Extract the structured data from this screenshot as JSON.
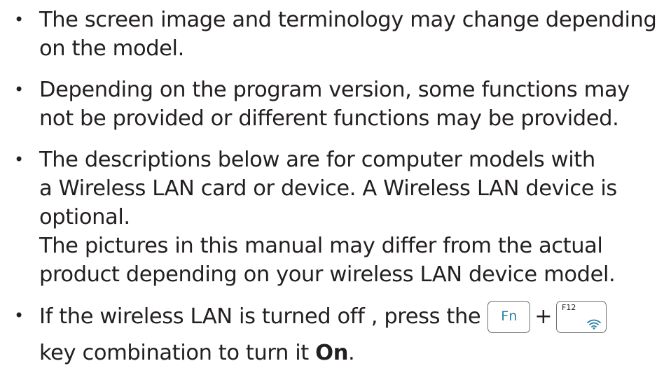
{
  "notes": [
    {
      "lines": [
        "The screen image and terminology may change depending",
        "on the model."
      ]
    },
    {
      "lines": [
        "Depending on the program version, some functions may",
        "not be provided or different functions may be provided."
      ]
    },
    {
      "lines": [
        "The descriptions below are for computer models with",
        "a Wireless LAN card or device. A Wireless LAN device is",
        "optional.",
        "The pictures in this manual may differ from the actual",
        "product depending on your wireless LAN device model."
      ]
    },
    {
      "before_keys": "If the wireless LAN is turned off , press the",
      "key_fn": "Fn",
      "plus": "+",
      "key_f12": "F12",
      "key_f12_icon": "wifi-icon",
      "after_keys": "key combination to turn it ",
      "emphasis": "On",
      "end": "."
    }
  ],
  "colors": {
    "text": "#231f20",
    "key_border": "#6d6e71",
    "fn_label": "#2a7fa5",
    "wifi_icon": "#2a7fa5"
  }
}
